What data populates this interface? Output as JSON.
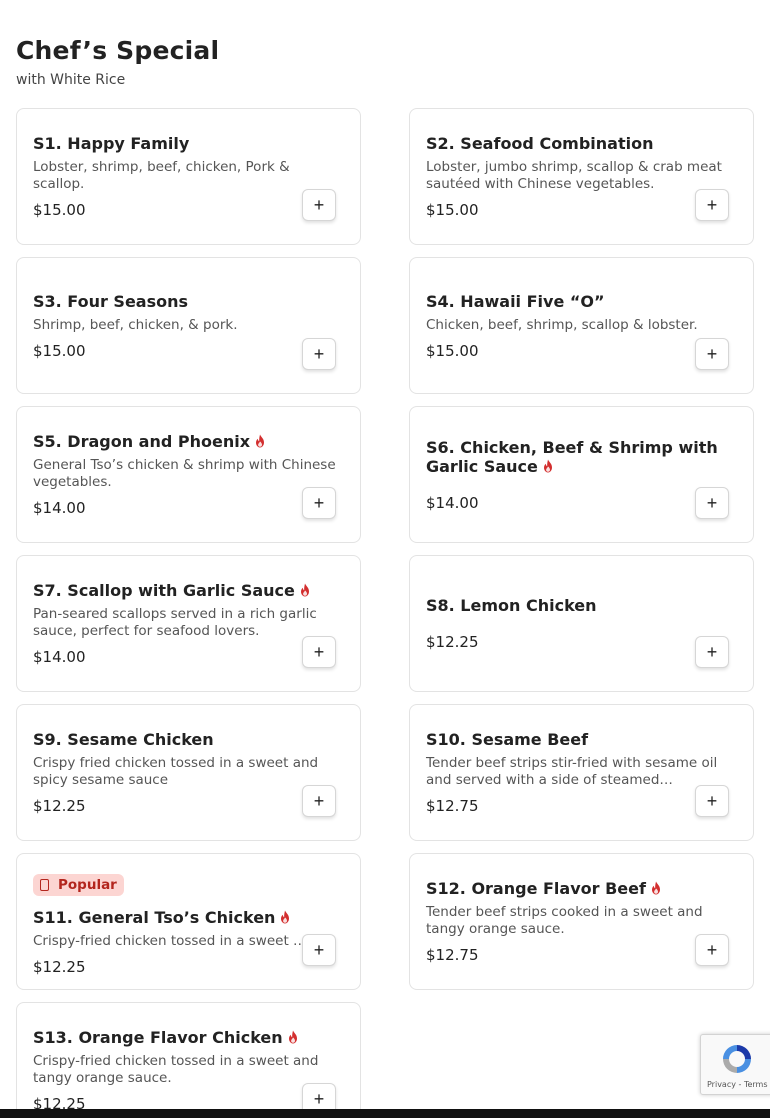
{
  "section": {
    "title": "Chef’s Special",
    "subtitle": "with White Rice"
  },
  "add_button_label": "+",
  "popular_badge": "Popular",
  "colors": {
    "spicy": "#d32f2f",
    "badge_bg": "#fcd5d2",
    "badge_text": "#b3261e"
  },
  "items": [
    {
      "name": "S1. Happy Family",
      "description": "Lobster, shrimp, beef, chicken, Pork & scallop.",
      "price": "$15.00",
      "spicy": false
    },
    {
      "name": "S2. Seafood Combination",
      "description": "Lobster, jumbo shrimp, scallop & crab meat sautéed with Chinese vegetables.",
      "price": "$15.00",
      "spicy": false
    },
    {
      "name": "S3. Four Seasons",
      "description": "Shrimp, beef, chicken, & pork.",
      "price": "$15.00",
      "spicy": false
    },
    {
      "name": "S4. Hawaii Five “O”",
      "description": "Chicken, beef, shrimp, scallop & lobster.",
      "price": "$15.00",
      "spicy": false
    },
    {
      "name": "S5. Dragon and Phoenix",
      "description": "General Tso’s chicken & shrimp with Chinese vegetables.",
      "price": "$14.00",
      "spicy": true
    },
    {
      "name": "S6. Chicken, Beef & Shrimp with Garlic Sauce",
      "description": "",
      "price": "$14.00",
      "spicy": true
    },
    {
      "name": "S7. Scallop with Garlic Sauce",
      "description": "Pan-seared scallops served in a rich garlic sauce, perfect for seafood lovers.",
      "price": "$14.00",
      "spicy": true
    },
    {
      "name": "S8. Lemon Chicken",
      "description": "",
      "price": "$12.25",
      "spicy": false
    },
    {
      "name": "S9. Sesame Chicken",
      "description": "Crispy fried chicken tossed in a sweet and spicy sesame sauce",
      "price": "$12.25",
      "spicy": false
    },
    {
      "name": "S10. Sesame Beef",
      "description": "Tender beef strips stir-fried with sesame oil and served with a side of steamed…",
      "price": "$12.75",
      "spicy": false
    },
    {
      "name": "S11. General Tso’s Chicken",
      "description": "Crispy-fried chicken tossed in a sweet …",
      "price": "$12.25",
      "spicy": true,
      "popular": true
    },
    {
      "name": "S12. Orange Flavor Beef",
      "description": "Tender beef strips cooked in a sweet and tangy orange sauce.",
      "price": "$12.75",
      "spicy": true
    },
    {
      "name": "S13. Orange Flavor Chicken",
      "description": "Crispy-fried chicken tossed in a sweet and tangy orange sauce.",
      "price": "$12.25",
      "spicy": true
    }
  ],
  "recaptcha": {
    "links": "Privacy - Terms"
  }
}
